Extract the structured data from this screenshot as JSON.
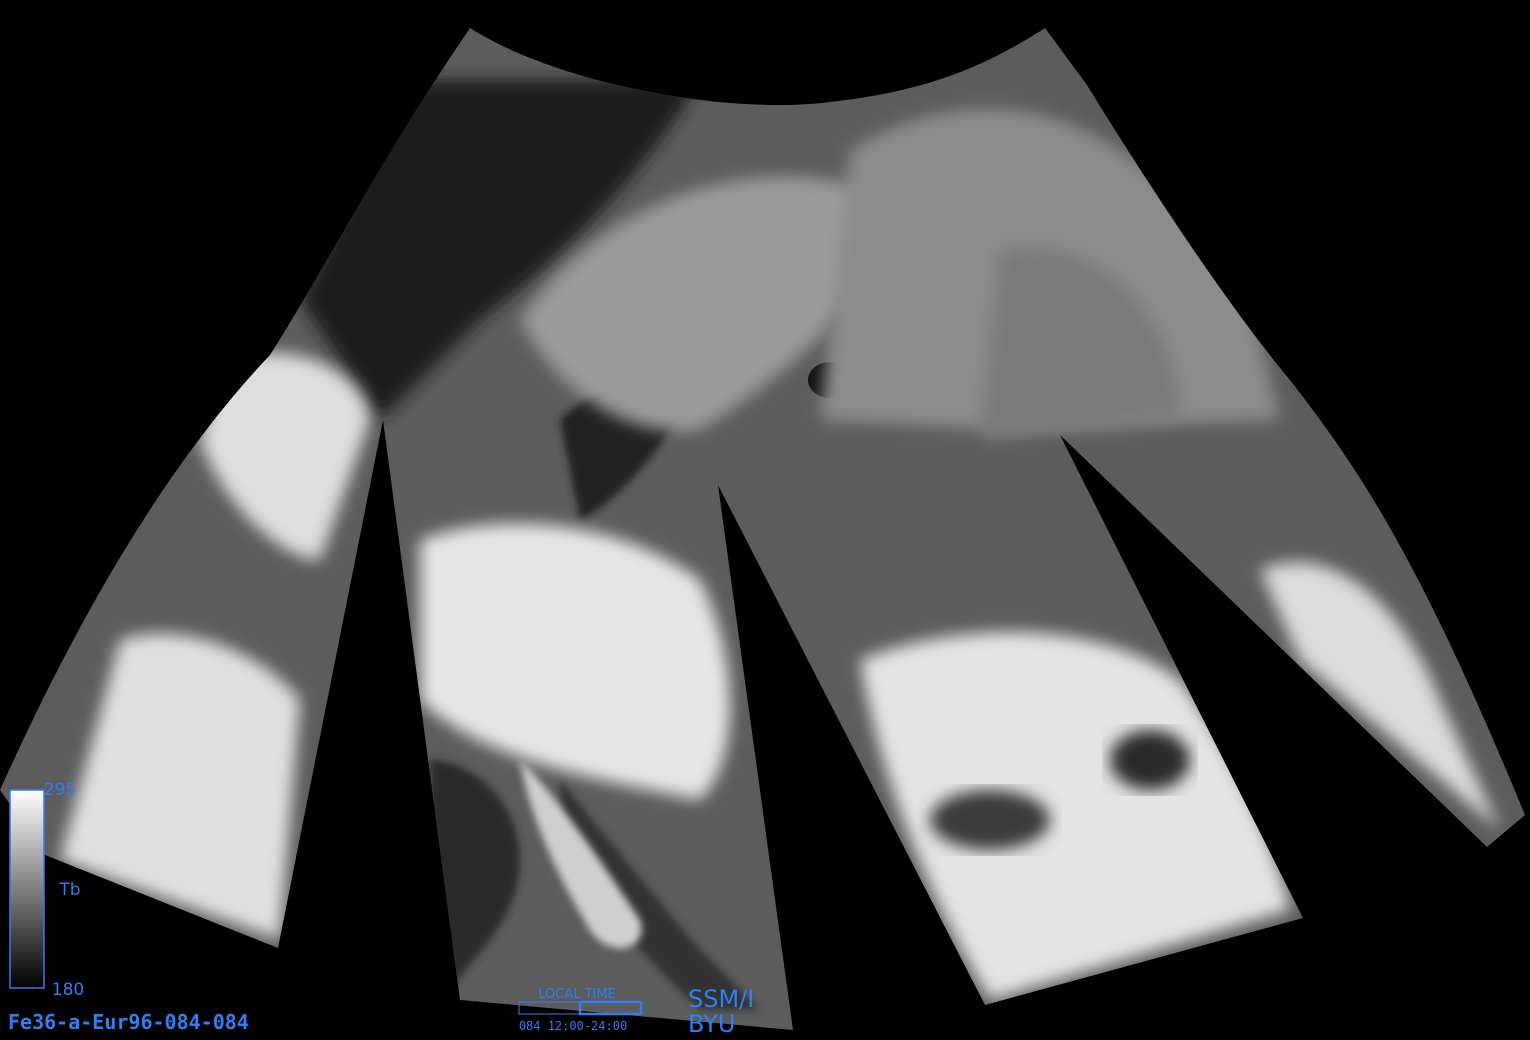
{
  "image": {
    "filename": "Fe36-a-Eur96-084-084",
    "sensor": "SSM/I",
    "institution": "BYU"
  },
  "colorbar": {
    "max_label": "295",
    "min_label": "180",
    "quantity_label": "Tb",
    "gradient_top": "#ffffff",
    "gradient_bottom": "#000000"
  },
  "local_time": {
    "title": "LOCAL TIME",
    "range_label": "084 12:00-24:00"
  },
  "colors": {
    "background": "#000000",
    "annotation_blue": "#2f7ff5"
  }
}
